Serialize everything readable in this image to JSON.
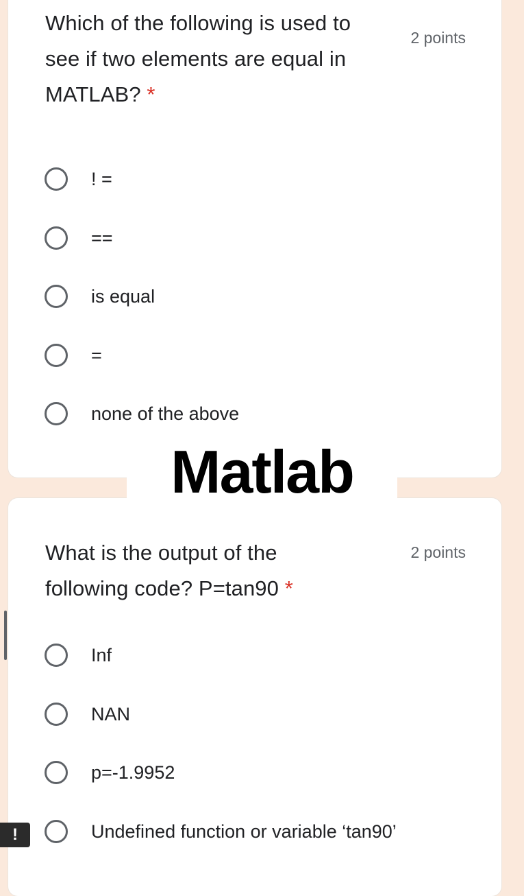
{
  "question1": {
    "text": "Which of the following is used to see if two elements are equal in MATLAB?",
    "required_marker": "*",
    "points": "2 points",
    "options": [
      {
        "label": "! ="
      },
      {
        "label": "=="
      },
      {
        "label": "is equal"
      },
      {
        "label": "="
      },
      {
        "label": "none of the above"
      }
    ]
  },
  "banner": {
    "text": "Matlab"
  },
  "question2": {
    "text": "What is the output of the following code? P=tan90",
    "required_marker": "*",
    "points": "2 points",
    "options": [
      {
        "label": "Inf"
      },
      {
        "label": "NAN"
      },
      {
        "label": "p=-1.9952"
      },
      {
        "label": "Undefined function or variable ‘tan90’"
      }
    ]
  },
  "alert": {
    "icon": "exclamation-icon",
    "glyph": "!"
  }
}
